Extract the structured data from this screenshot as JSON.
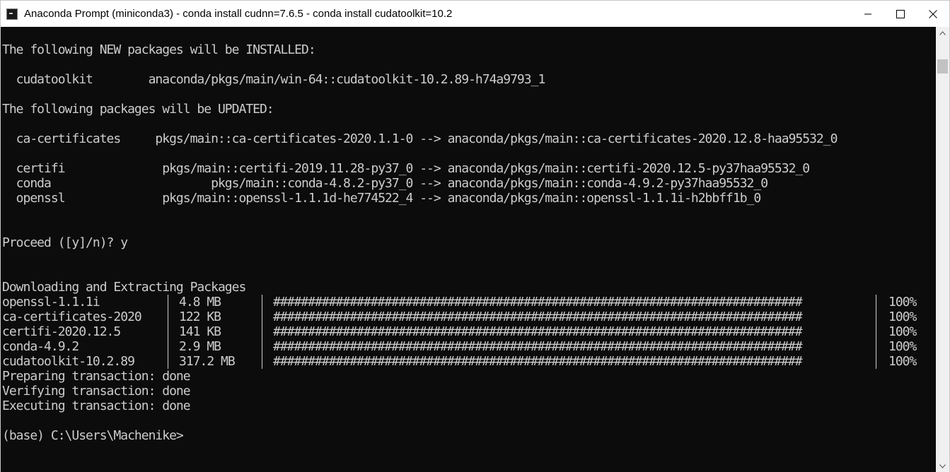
{
  "window": {
    "title": "Anaconda Prompt (miniconda3) - conda  install cudnn=7.6.5 - conda  install cudatoolkit=10.2",
    "icon": "terminal-icon"
  },
  "controls": {
    "minimize": "minimize-icon",
    "maximize": "maximize-icon",
    "close": "close-icon"
  },
  "terminal": {
    "lines_top": [
      "The following NEW packages will be INSTALLED:",
      "",
      "  cudatoolkit        anaconda/pkgs/main/win-64::cudatoolkit-10.2.89-h74a9793_1",
      "",
      "The following packages will be UPDATED:",
      "",
      "  ca-certificates     pkgs/main::ca-certificates-2020.1.1-0 --> anaconda/pkgs/main::ca-certificates-2020.12.8-haa95532_0",
      "",
      "  certifi              pkgs/main::certifi-2019.11.28-py37_0 --> anaconda/pkgs/main::certifi-2020.12.5-py37haa95532_0",
      "  conda                       pkgs/main::conda-4.8.2-py37_0 --> anaconda/pkgs/main::conda-4.9.2-py37haa95532_0",
      "  openssl              pkgs/main::openssl-1.1.1d-he774522_4 --> anaconda/pkgs/main::openssl-1.1.1i-h2bbff1b_0",
      "",
      "",
      "Proceed ([y]/n)? y",
      "",
      "",
      "Downloading and Extracting Packages"
    ],
    "downloads": [
      {
        "name": "openssl-1.1.1i",
        "size": "4.8 MB",
        "progress": 100,
        "percent_text": "100%"
      },
      {
        "name": "ca-certificates-2020",
        "size": "122 KB",
        "progress": 100,
        "percent_text": "100%"
      },
      {
        "name": "certifi-2020.12.5",
        "size": "141 KB",
        "progress": 100,
        "percent_text": "100%"
      },
      {
        "name": "conda-4.9.2",
        "size": "2.9 MB",
        "progress": 100,
        "percent_text": "100%"
      },
      {
        "name": "cudatoolkit-10.2.89",
        "size": "317.2 MB",
        "progress": 100,
        "percent_text": "100%"
      }
    ],
    "progress_bar_text": "############################################################################",
    "lines_bottom": [
      "Preparing transaction: done",
      "Verifying transaction: done",
      "Executing transaction: done",
      "",
      "(base) C:\\Users\\Machenike>"
    ]
  }
}
